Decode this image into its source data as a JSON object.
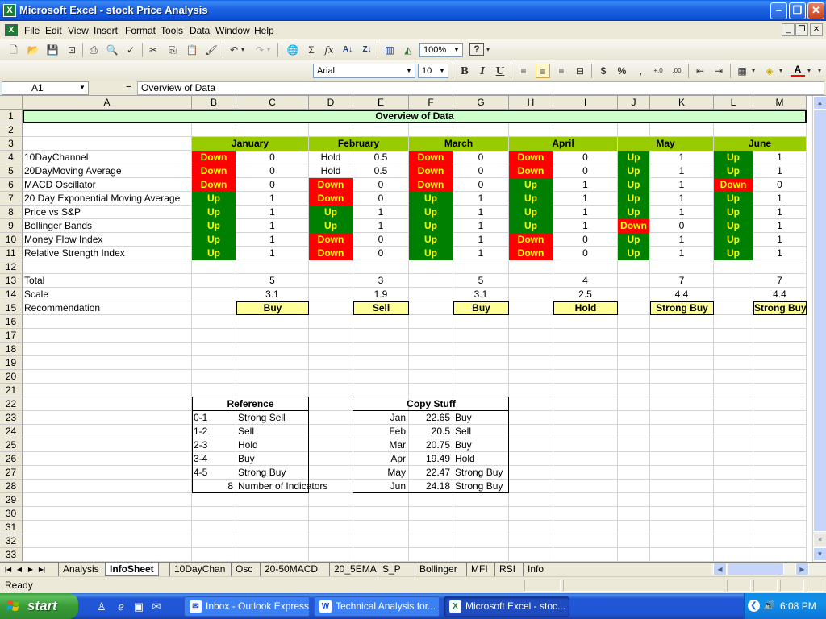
{
  "window": {
    "title": "Microsoft Excel - stock Price Analysis"
  },
  "menu": [
    "File",
    "Edit",
    "View",
    "Insert",
    "Format",
    "Tools",
    "Data",
    "Window",
    "Help"
  ],
  "toolbar": {
    "zoom": "100%",
    "font": "Arial",
    "font_size": "10"
  },
  "formula_bar": {
    "cell_ref": "A1",
    "equals": "=",
    "content": "Overview of Data"
  },
  "columns": [
    "A",
    "B",
    "C",
    "D",
    "E",
    "F",
    "G",
    "H",
    "I",
    "J",
    "K",
    "L",
    "M"
  ],
  "rows": [
    "1",
    "2",
    "3",
    "4",
    "5",
    "6",
    "7",
    "8",
    "9",
    "10",
    "11",
    "12",
    "13",
    "14",
    "15",
    "16",
    "17",
    "18",
    "19",
    "20",
    "21",
    "22",
    "23",
    "24",
    "25",
    "26",
    "27",
    "28",
    "29",
    "30",
    "31",
    "32",
    "33"
  ],
  "sheet": {
    "title": "Overview of Data",
    "months": [
      "January",
      "February",
      "March",
      "April",
      "May",
      "June"
    ],
    "indicators": [
      {
        "name": "10DayChannel",
        "signals": [
          "Down",
          "Hold",
          "Down",
          "Down",
          "Up",
          "Up"
        ],
        "values": [
          "0",
          "0.5",
          "0",
          "0",
          "1",
          "1"
        ]
      },
      {
        "name": "20DayMoving Average",
        "signals": [
          "Down",
          "Hold",
          "Down",
          "Down",
          "Up",
          "Up"
        ],
        "values": [
          "0",
          "0.5",
          "0",
          "0",
          "1",
          "1"
        ]
      },
      {
        "name": "MACD Oscillator",
        "signals": [
          "Down",
          "Down",
          "Down",
          "Up",
          "Up",
          "Down"
        ],
        "values": [
          "0",
          "0",
          "0",
          "1",
          "1",
          "0"
        ]
      },
      {
        "name": "20 Day Exponential Moving Average",
        "signals": [
          "Up",
          "Down",
          "Up",
          "Up",
          "Up",
          "Up"
        ],
        "values": [
          "1",
          "0",
          "1",
          "1",
          "1",
          "1"
        ]
      },
      {
        "name": "Price vs S&P",
        "signals": [
          "Up",
          "Up",
          "Up",
          "Up",
          "Up",
          "Up"
        ],
        "values": [
          "1",
          "1",
          "1",
          "1",
          "1",
          "1"
        ]
      },
      {
        "name": "Bollinger Bands",
        "signals": [
          "Up",
          "Up",
          "Up",
          "Up",
          "Down",
          "Up"
        ],
        "values": [
          "1",
          "1",
          "1",
          "1",
          "0",
          "1"
        ]
      },
      {
        "name": "Money Flow Index",
        "signals": [
          "Up",
          "Down",
          "Up",
          "Down",
          "Up",
          "Up"
        ],
        "values": [
          "1",
          "0",
          "1",
          "0",
          "1",
          "1"
        ]
      },
      {
        "name": "Relative Strength Index",
        "signals": [
          "Up",
          "Down",
          "Up",
          "Down",
          "Up",
          "Up"
        ],
        "values": [
          "1",
          "0",
          "1",
          "0",
          "1",
          "1"
        ]
      }
    ],
    "total_label": "Total",
    "scale_label": "Scale",
    "recommendation_label": "Recommendation",
    "totals": [
      "5",
      "3",
      "5",
      "4",
      "7",
      "7"
    ],
    "scales": [
      "3.1",
      "1.9",
      "3.1",
      "2.5",
      "4.4",
      "4.4"
    ],
    "recommendations": [
      "Buy",
      "Sell",
      "Buy",
      "Hold",
      "Strong Buy",
      "Strong Buy"
    ],
    "reference": {
      "header": "Reference",
      "rows": [
        [
          "0-1",
          "Strong Sell"
        ],
        [
          "1-2",
          "Sell"
        ],
        [
          "2-3",
          "Hold"
        ],
        [
          "3-4",
          "Buy"
        ],
        [
          "4-5",
          "Strong Buy"
        ],
        [
          "8",
          "Number of Indicators"
        ]
      ]
    },
    "copy_stuff": {
      "header": "Copy Stuff",
      "rows": [
        [
          "Jan",
          "22.65",
          "Buy"
        ],
        [
          "Feb",
          "20.5",
          "Sell"
        ],
        [
          "Mar",
          "20.75",
          "Buy"
        ],
        [
          "Apr",
          "19.49",
          "Hold"
        ],
        [
          "May",
          "22.47",
          "Strong Buy"
        ],
        [
          "Jun",
          "24.18",
          "Strong Buy"
        ]
      ]
    }
  },
  "sheet_tabs": [
    "Analysis",
    "InfoSheet",
    "10DayChan",
    "Osc",
    "20-50MACD",
    "20_5EMA",
    "S_P",
    "Bollinger",
    "MFI",
    "RSI",
    "Info"
  ],
  "active_tab": "InfoSheet",
  "status": "Ready",
  "taskbar": {
    "start": "start",
    "tasks": [
      "Inbox - Outlook Express",
      "Technical Analysis for...",
      "Microsoft Excel - stoc..."
    ],
    "clock": "6:08 PM"
  },
  "colors": {
    "down": "#FF0000",
    "up": "#008000",
    "signal_text": "#FFFF00",
    "month_header": "#99CC00",
    "recommendation": "#FFFF99",
    "title_row": "#CCFFCC"
  }
}
